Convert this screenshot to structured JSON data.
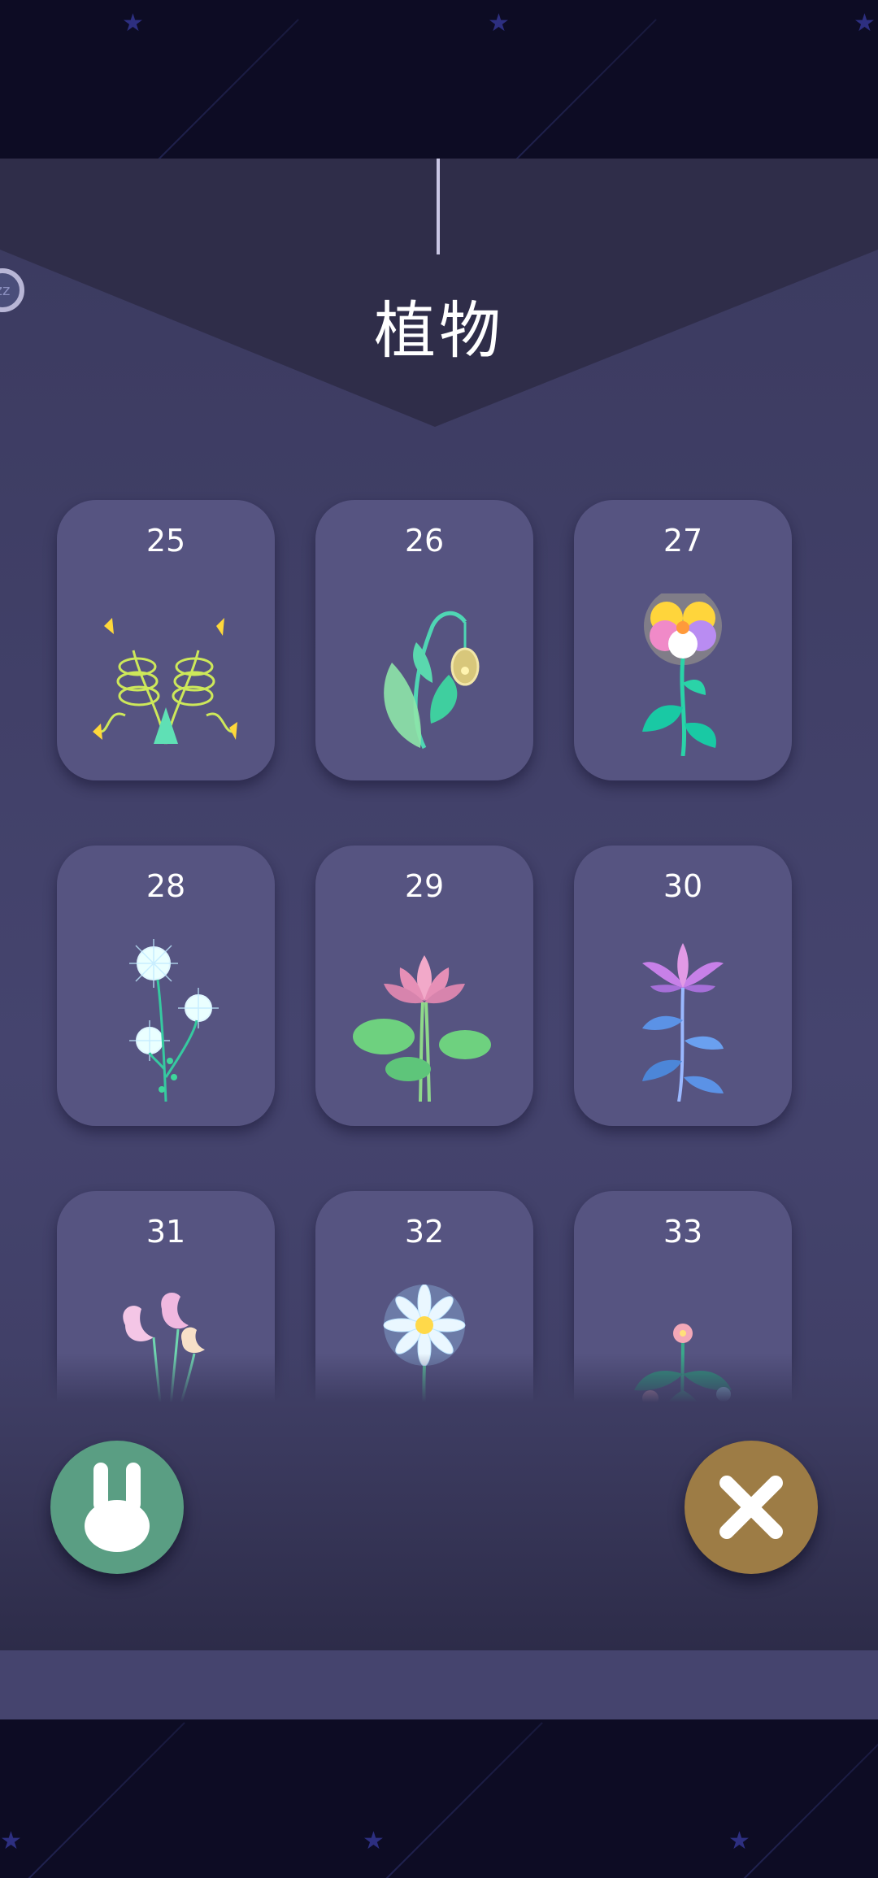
{
  "header": {
    "title": "植物"
  },
  "sleep_badge": {
    "label": "zz"
  },
  "plants": [
    {
      "number": "25",
      "icon": "spring-bulb-plant-icon"
    },
    {
      "number": "26",
      "icon": "lightbulb-sprout-icon"
    },
    {
      "number": "27",
      "icon": "pansy-flower-icon"
    },
    {
      "number": "28",
      "icon": "dandelion-puff-icon"
    },
    {
      "number": "29",
      "icon": "lotus-flower-icon"
    },
    {
      "number": "30",
      "icon": "lily-flower-icon"
    },
    {
      "number": "31",
      "icon": "swan-orchid-icon"
    },
    {
      "number": "32",
      "icon": "white-daisy-icon"
    },
    {
      "number": "33",
      "icon": "wildflower-bush-icon"
    }
  ],
  "buttons": {
    "bunny": {
      "icon": "rabbit-icon",
      "color": "#5a9e83"
    },
    "close": {
      "icon": "close-icon",
      "color": "#9d7c45"
    }
  },
  "colors": {
    "panel": "#45446e",
    "card": "#565481",
    "background": "#0d0c24"
  }
}
